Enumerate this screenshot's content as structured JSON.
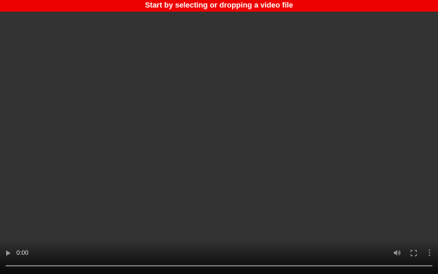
{
  "banner": {
    "text": "Start by selecting or dropping a video file",
    "background": "#ee0000"
  },
  "player": {
    "background": "#333333",
    "current_time": "0:00",
    "progress": 0,
    "icons": {
      "play": "play-icon",
      "volume": "volume-icon",
      "fullscreen": "fullscreen-icon",
      "more": "more-options-icon"
    }
  }
}
